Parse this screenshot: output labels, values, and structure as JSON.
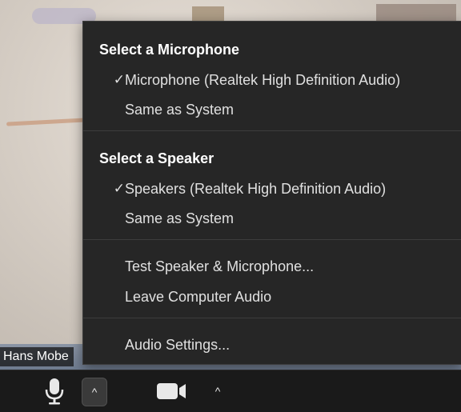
{
  "name_tag": "Hans Mobe",
  "menu": {
    "microphone_title": "Select a Microphone",
    "microphone_items": [
      {
        "label": "Microphone (Realtek High Definition Audio)",
        "checked": true
      },
      {
        "label": "Same as System",
        "checked": false
      }
    ],
    "speaker_title": "Select a Speaker",
    "speaker_items": [
      {
        "label": "Speakers (Realtek High Definition Audio)",
        "checked": true
      },
      {
        "label": "Same as System",
        "checked": false
      }
    ],
    "test_label": "Test Speaker & Microphone...",
    "leave_label": "Leave Computer Audio",
    "settings_label": "Audio Settings...",
    "check_glyph": "✓"
  },
  "toolbar": {
    "mic_caret": "^",
    "video_caret": "^"
  }
}
